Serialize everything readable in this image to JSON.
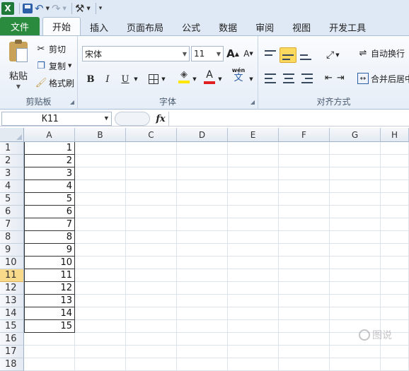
{
  "qat": {
    "app_icon": "X",
    "save_icon": "save-icon",
    "undo_icon": "undo-icon",
    "redo_icon": "redo-icon",
    "tools_icon": "tools-icon",
    "customize_icon": "customize-icon"
  },
  "tabs": [
    {
      "label": "文件"
    },
    {
      "label": "开始"
    },
    {
      "label": "插入"
    },
    {
      "label": "页面布局"
    },
    {
      "label": "公式"
    },
    {
      "label": "数据"
    },
    {
      "label": "审阅"
    },
    {
      "label": "视图"
    },
    {
      "label": "开发工具"
    }
  ],
  "clipboard": {
    "paste": "粘贴",
    "cut": "剪切",
    "copy": "复制",
    "format_painter": "格式刷",
    "group_label": "剪贴板"
  },
  "font": {
    "name": "宋体",
    "size": "11",
    "grow": "A",
    "shrink": "A",
    "bold": "B",
    "italic": "I",
    "underline": "U",
    "font_color_letter": "A",
    "phonetic": "wén",
    "phonetic_char": "文",
    "group_label": "字体",
    "highlight_color": "#ffe800",
    "font_color": "#e02020"
  },
  "alignment": {
    "wrap_text": "自动换行",
    "merge_center": "合并后居中",
    "group_label": "对齐方式"
  },
  "formula_bar": {
    "name_box": "K11",
    "fx": "fx",
    "value": ""
  },
  "columns": [
    "A",
    "B",
    "C",
    "D",
    "E",
    "F",
    "G",
    "H"
  ],
  "rows": [
    "1",
    "2",
    "3",
    "4",
    "5",
    "6",
    "7",
    "8",
    "9",
    "10",
    "11",
    "12",
    "13",
    "14",
    "15",
    "16",
    "17",
    "18"
  ],
  "cells_a": [
    "1",
    "2",
    "3",
    "4",
    "5",
    "6",
    "7",
    "8",
    "9",
    "10",
    "11",
    "12",
    "13",
    "14",
    "15"
  ],
  "selected_row": "11",
  "watermark": "图说"
}
